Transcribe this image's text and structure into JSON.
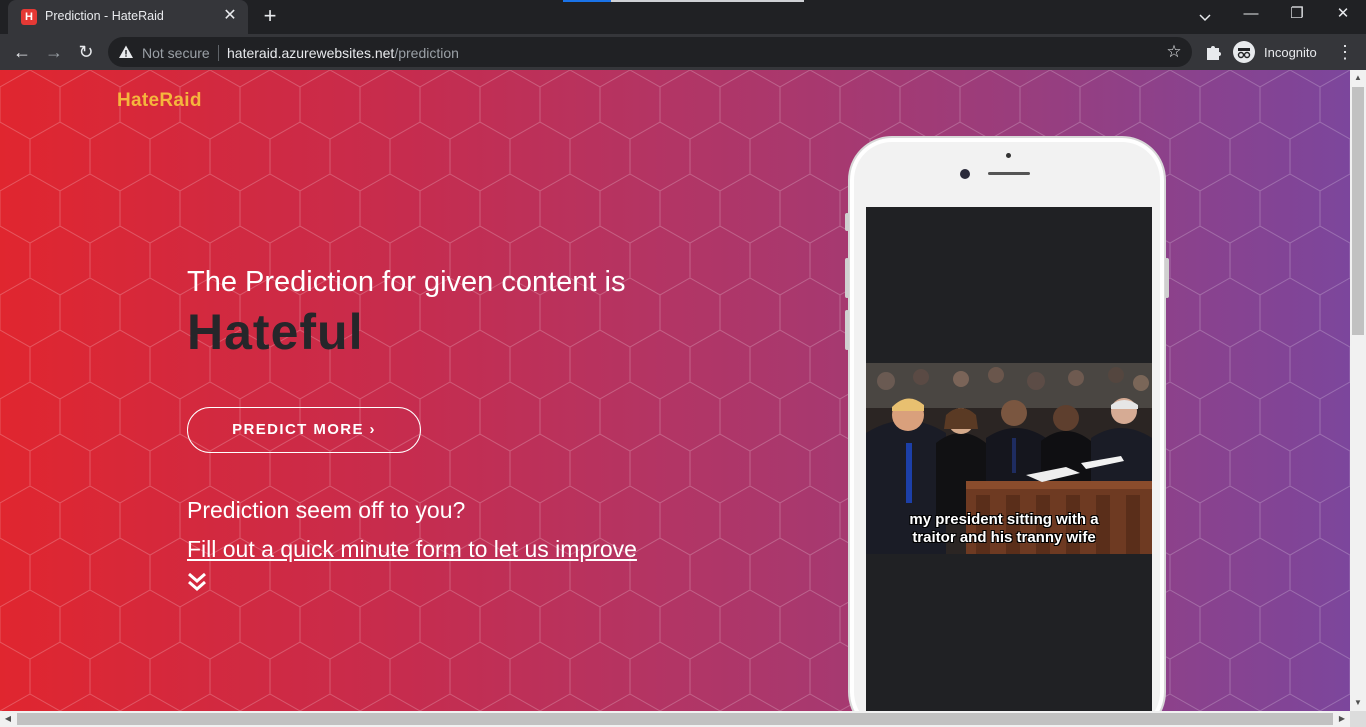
{
  "browser": {
    "tab_title": "Prediction - HateRaid",
    "tab_favicon_letter": "H",
    "security_label": "Not secure",
    "url_host": "hateraid.azurewebsites.net",
    "url_path": "/prediction",
    "profile_label": "Incognito",
    "icons": [
      "new-tab-icon",
      "tab-search-icon",
      "back-icon",
      "forward-icon",
      "reload-icon",
      "warning-icon",
      "star-icon",
      "extensions-icon",
      "incognito-icon",
      "menu-icon"
    ]
  },
  "page": {
    "brand": "HateRaid",
    "intro": "The Prediction for given content is",
    "verdict": "Hateful",
    "predict_more_label": "PREDICT MORE",
    "off_question": "Prediction seem off to you?",
    "form_link": "Fill out a quick minute form to let us improve",
    "meme_caption_line1": "my president sitting with a",
    "meme_caption_line2": "traitor and his tranny wife"
  },
  "colors": {
    "brand": "#f5b63d",
    "gradient_start": "#e0262f",
    "gradient_end": "#7c469c",
    "verdict": "#26262a"
  }
}
